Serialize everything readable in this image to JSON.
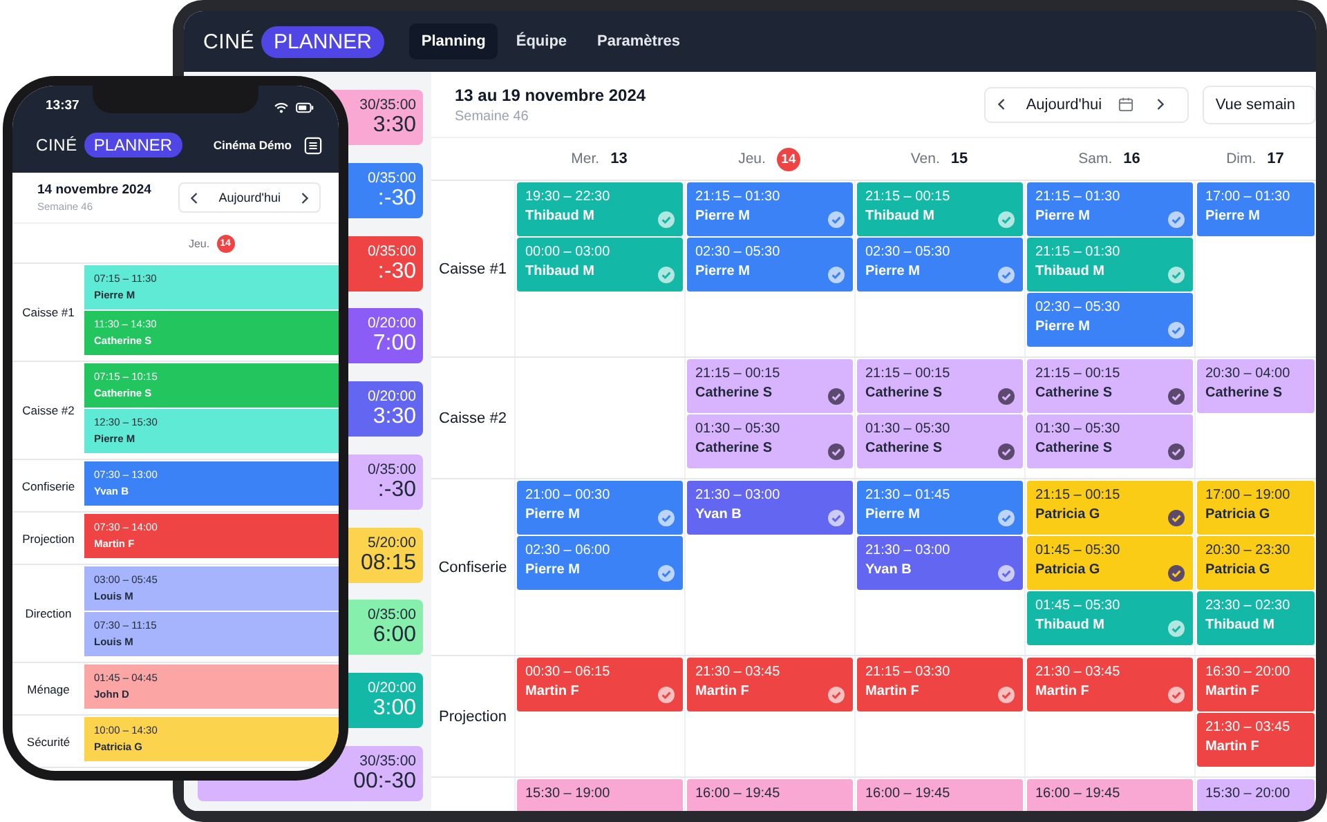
{
  "tablet": {
    "logo": {
      "text": "CINÉ",
      "badge": "PLANNER"
    },
    "nav": [
      {
        "label": "Planning",
        "selected": true
      },
      {
        "label": "Équipe",
        "selected": false
      },
      {
        "label": "Paramètres",
        "selected": false
      }
    ],
    "hour_cards": [
      {
        "hours": "30/35:00",
        "balance": "3:30",
        "color": "#f9a8d4"
      },
      {
        "hours": "0/35:00",
        "balance": ":-30",
        "color": "#3b82f6"
      },
      {
        "hours": "0/35:00",
        "balance": ":-30",
        "color": "#ef4444"
      },
      {
        "hours": "0/20:00",
        "balance": "7:00",
        "color": "#8b5cf6"
      },
      {
        "hours": "0/20:00",
        "balance": "3:30",
        "color": "#6366f1"
      },
      {
        "hours": "0/35:00",
        "balance": ":-30",
        "color": "#d8b4fe"
      },
      {
        "hours": "5/20:00",
        "balance": "08:15",
        "color": "#fcd34d"
      },
      {
        "hours": "0/35:00",
        "balance": "6:00",
        "color": "#86efac"
      },
      {
        "hours": "0/20:00",
        "balance": "3:00",
        "color": "#14b8a6"
      },
      {
        "hours": "30/35:00",
        "balance": "00:-30",
        "color": "#d8b4fe"
      }
    ],
    "period": {
      "title": "13 au 19 novembre 2024",
      "week": "Semaine 46"
    },
    "today_button": "Aujourd'hui",
    "view_button": "Vue semain",
    "days": [
      {
        "name": "Mer.",
        "date": "13",
        "today": false
      },
      {
        "name": "Jeu.",
        "date": "14",
        "today": true
      },
      {
        "name": "Ven.",
        "date": "15",
        "today": false
      },
      {
        "name": "Sam.",
        "date": "16",
        "today": false
      },
      {
        "name": "Dim.",
        "date": "17",
        "today": false
      }
    ],
    "rows": [
      {
        "label": "Caisse #1",
        "cells": [
          [
            {
              "time": "19:30 – 22:30",
              "name": "Thibaud M",
              "color": "#14b8a6",
              "confirmed": true
            },
            {
              "time": "00:00 – 03:00",
              "name": "Thibaud M",
              "color": "#14b8a6",
              "confirmed": true
            }
          ],
          [
            {
              "time": "21:15 – 01:30",
              "name": "Pierre M",
              "color": "#3b82f6",
              "confirmed": true
            },
            {
              "time": "02:30 – 05:30",
              "name": "Pierre M",
              "color": "#3b82f6",
              "confirmed": true
            }
          ],
          [
            {
              "time": "21:15 – 00:15",
              "name": "Thibaud M",
              "color": "#14b8a6",
              "confirmed": true
            },
            {
              "time": "02:30 – 05:30",
              "name": "Pierre M",
              "color": "#3b82f6",
              "confirmed": true
            }
          ],
          [
            {
              "time": "21:15 – 01:30",
              "name": "Pierre M",
              "color": "#3b82f6",
              "confirmed": true
            },
            {
              "time": "21:15 – 01:30",
              "name": "Thibaud M",
              "color": "#14b8a6",
              "confirmed": true
            },
            {
              "time": "02:30 – 05:30",
              "name": "Pierre M",
              "color": "#3b82f6",
              "confirmed": true
            }
          ],
          [
            {
              "time": "17:00 – 01:30",
              "name": "Pierre M",
              "color": "#3b82f6",
              "confirmed": false
            }
          ]
        ]
      },
      {
        "label": "Caisse #2",
        "cells": [
          [],
          [
            {
              "time": "21:15 – 00:15",
              "name": "Catherine S",
              "color": "#d8b4fe",
              "confirmed": true
            },
            {
              "time": "01:30 – 05:30",
              "name": "Catherine S",
              "color": "#d8b4fe",
              "confirmed": true
            }
          ],
          [
            {
              "time": "21:15 – 00:15",
              "name": "Catherine S",
              "color": "#d8b4fe",
              "confirmed": true
            },
            {
              "time": "01:30 – 05:30",
              "name": "Catherine S",
              "color": "#d8b4fe",
              "confirmed": true
            }
          ],
          [
            {
              "time": "21:15 – 00:15",
              "name": "Catherine S",
              "color": "#d8b4fe",
              "confirmed": true
            },
            {
              "time": "01:30 – 05:30",
              "name": "Catherine S",
              "color": "#d8b4fe",
              "confirmed": true
            }
          ],
          [
            {
              "time": "20:30 – 04:00",
              "name": "Catherine S",
              "color": "#d8b4fe",
              "confirmed": false
            }
          ]
        ]
      },
      {
        "label": "Confiserie",
        "cells": [
          [
            {
              "time": "21:00 – 00:30",
              "name": "Pierre M",
              "color": "#3b82f6",
              "confirmed": true
            },
            {
              "time": "02:30 – 06:00",
              "name": "Pierre M",
              "color": "#3b82f6",
              "confirmed": true
            }
          ],
          [
            {
              "time": "21:30 – 03:00",
              "name": "Yvan B",
              "color": "#6366f1",
              "confirmed": true
            }
          ],
          [
            {
              "time": "21:30 – 01:45",
              "name": "Pierre M",
              "color": "#3b82f6",
              "confirmed": true
            },
            {
              "time": "21:30 – 03:00",
              "name": "Yvan B",
              "color": "#6366f1",
              "confirmed": true
            }
          ],
          [
            {
              "time": "21:15 – 00:15",
              "name": "Patricia G",
              "color": "#facc15",
              "confirmed": true
            },
            {
              "time": "01:45 – 05:30",
              "name": "Patricia G",
              "color": "#facc15",
              "confirmed": true
            },
            {
              "time": "01:45 – 05:30",
              "name": "Thibaud M",
              "color": "#14b8a6",
              "confirmed": true
            }
          ],
          [
            {
              "time": "17:00 – 19:00",
              "name": "Patricia G",
              "color": "#facc15",
              "confirmed": false
            },
            {
              "time": "20:30 – 23:30",
              "name": "Patricia G",
              "color": "#facc15",
              "confirmed": false
            },
            {
              "time": "23:30 – 02:30",
              "name": "Thibaud M",
              "color": "#14b8a6",
              "confirmed": false
            }
          ]
        ]
      },
      {
        "label": "Projection",
        "cells": [
          [
            {
              "time": "00:30 – 06:15",
              "name": "Martin F",
              "color": "#ef4444",
              "confirmed": true
            }
          ],
          [
            {
              "time": "21:30 – 03:45",
              "name": "Martin F",
              "color": "#ef4444",
              "confirmed": true
            }
          ],
          [
            {
              "time": "21:15 – 03:30",
              "name": "Martin F",
              "color": "#ef4444",
              "confirmed": true
            }
          ],
          [
            {
              "time": "21:30 – 03:45",
              "name": "Martin F",
              "color": "#ef4444",
              "confirmed": true
            }
          ],
          [
            {
              "time": "16:30 – 20:00",
              "name": "Martin F",
              "color": "#ef4444",
              "confirmed": false
            },
            {
              "time": "21:30 – 03:45",
              "name": "Martin F",
              "color": "#ef4444",
              "confirmed": false
            }
          ]
        ]
      },
      {
        "cells": [
          [
            {
              "time": "15:30 – 19:00",
              "color": "#f9a8d4",
              "confirmed": false
            }
          ],
          [
            {
              "time": "16:00 – 19:45",
              "color": "#f9a8d4",
              "confirmed": false
            }
          ],
          [
            {
              "time": "16:00 – 19:45",
              "color": "#f9a8d4",
              "confirmed": false
            }
          ],
          [
            {
              "time": "16:00 – 19:45",
              "color": "#f9a8d4",
              "confirmed": false
            }
          ],
          [
            {
              "time": "15:30 – 20:00",
              "color": "#d8b4fe",
              "confirmed": false
            }
          ]
        ]
      }
    ]
  },
  "phone": {
    "status_time": "13:37",
    "logo": {
      "text": "CINÉ",
      "badge": "PLANNER"
    },
    "cinema": "Cinéma Démo",
    "date": {
      "title": "14 novembre 2024",
      "week": "Semaine 46"
    },
    "today_button": "Aujourd'hui",
    "day": {
      "name": "Jeu.",
      "date": "14",
      "today": true
    },
    "rows": [
      {
        "label": "Caisse #1",
        "shifts": [
          {
            "time": "07:15 – 11:30",
            "name": "Pierre M",
            "color": "#5eead4"
          },
          {
            "time": "11:30 – 14:30",
            "name": "Catherine S",
            "color": "#22c55e"
          }
        ]
      },
      {
        "label": "Caisse #2",
        "shifts": [
          {
            "time": "07:15 – 10:15",
            "name": "Catherine S",
            "color": "#22c55e"
          },
          {
            "time": "12:30 – 15:30",
            "name": "Pierre M",
            "color": "#5eead4"
          }
        ]
      },
      {
        "label": "Confiserie",
        "shifts": [
          {
            "time": "07:30 – 13:00",
            "name": "Yvan B",
            "color": "#3b82f6"
          }
        ]
      },
      {
        "label": "Projection",
        "shifts": [
          {
            "time": "07:30 – 14:00",
            "name": "Martin F",
            "color": "#ef4444"
          }
        ]
      },
      {
        "label": "Direction",
        "shifts": [
          {
            "time": "03:00 – 05:45",
            "name": "Louis M",
            "color": "#a5b4fc"
          },
          {
            "time": "07:30 – 11:15",
            "name": "Louis M",
            "color": "#a5b4fc"
          }
        ]
      },
      {
        "label": "Ménage",
        "shifts": [
          {
            "time": "01:45 – 04:45",
            "name": "John D",
            "color": "#fca5a5"
          }
        ]
      },
      {
        "label": "Sécurité",
        "shifts": [
          {
            "time": "10:00 – 14:30",
            "name": "Patricia G",
            "color": "#fcd34d"
          }
        ]
      }
    ]
  }
}
